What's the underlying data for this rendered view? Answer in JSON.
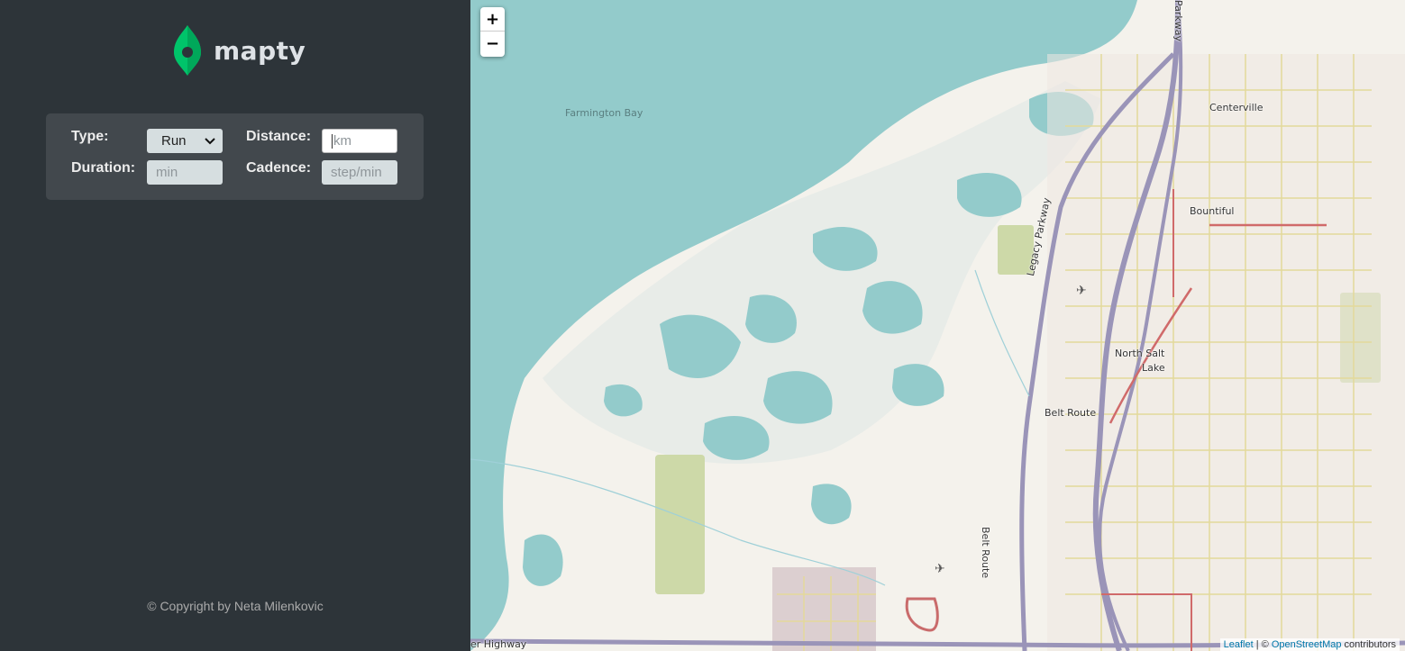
{
  "app": {
    "name": "mapty"
  },
  "form": {
    "type_label": "Type:",
    "type_value": "Run",
    "distance_label": "Distance:",
    "distance_placeholder": "km",
    "duration_label": "Duration:",
    "duration_placeholder": "min",
    "cadence_label": "Cadence:",
    "cadence_placeholder": "step/min"
  },
  "footer": {
    "copyright": "© Copyright by Neta Milenkovic"
  },
  "map": {
    "zoom_in": "+",
    "zoom_out": "−",
    "labels": {
      "bay": "Farmington Bay",
      "centerville": "Centerville",
      "bountiful": "Bountiful",
      "north_salt_lake_1": "North Salt",
      "north_salt_lake_2": "Lake",
      "belt_route_1": "Belt Route",
      "belt_route_2": "Belt Route",
      "legacy_parkway": "Legacy Parkway",
      "parkway": "Parkway",
      "highway": "er Highway"
    },
    "attribution": {
      "leaflet": "Leaflet",
      "separator": " | © ",
      "osm": "OpenStreetMap",
      "suffix": " contributors"
    }
  },
  "colors": {
    "sidebar_bg": "#2d3439",
    "form_bg": "#42484d",
    "brand_green": "#00c46a",
    "water": "#aad3df",
    "land": "#f2efe9"
  }
}
